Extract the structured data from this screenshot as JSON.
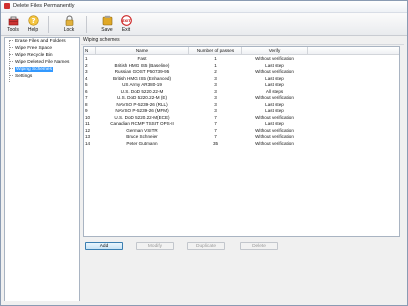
{
  "window": {
    "title": "Delete Files Permanently"
  },
  "toolbar": {
    "buttons": [
      {
        "label": "Tools",
        "icon": "tools-icon"
      },
      {
        "label": "Help",
        "icon": "help-icon"
      },
      {
        "label": "Lock",
        "icon": "lock-icon"
      },
      {
        "label": "Save",
        "icon": "save-icon"
      },
      {
        "label": "Exit",
        "icon": "exit-icon"
      }
    ]
  },
  "tree": {
    "items": [
      {
        "label": "Erase Files and Folders"
      },
      {
        "label": "Wipe Free Space"
      },
      {
        "label": "Wipe Recycle Bin"
      },
      {
        "label": "Wipe Deleted File Names"
      },
      {
        "label": "Wiping Schemes",
        "selected": true
      },
      {
        "label": "Settings"
      }
    ]
  },
  "panel": {
    "title": "Wiping schemes"
  },
  "table": {
    "headers": {
      "n": "N",
      "name": "Name",
      "passes": "Number of passes",
      "verify": "Verify"
    },
    "rows": [
      {
        "n": "1",
        "name": "Fast",
        "passes": "1",
        "verify": "Without verification"
      },
      {
        "n": "2",
        "name": "British HMG IS5 (Baseline)",
        "passes": "1",
        "verify": "Last step"
      },
      {
        "n": "3",
        "name": "Russian GOST P50739-95",
        "passes": "2",
        "verify": "Without verification"
      },
      {
        "n": "4",
        "name": "British HMG IS5 (Enhanced)",
        "passes": "3",
        "verify": "Last step"
      },
      {
        "n": "5",
        "name": "US Army AR380-19",
        "passes": "3",
        "verify": "Last step"
      },
      {
        "n": "6",
        "name": "U.S. DoD 5220.22-M",
        "passes": "3",
        "verify": "All steps"
      },
      {
        "n": "7",
        "name": "U.S. DoD 5220.22-M (E)",
        "passes": "3",
        "verify": "Without verification"
      },
      {
        "n": "8",
        "name": "NAVSO P-5239-26 (RLL)",
        "passes": "3",
        "verify": "Last step"
      },
      {
        "n": "9",
        "name": "NAVSO P-5239-26 (MFM)",
        "passes": "3",
        "verify": "Last step"
      },
      {
        "n": "10",
        "name": "U.S. DoD 5220.22-M(ECE)",
        "passes": "7",
        "verify": "Without verification"
      },
      {
        "n": "11",
        "name": "Canadian RCMP TSSIT OPS-II",
        "passes": "7",
        "verify": "Last step"
      },
      {
        "n": "12",
        "name": "German VSITR",
        "passes": "7",
        "verify": "Without verification"
      },
      {
        "n": "13",
        "name": "Bruce Schneier",
        "passes": "7",
        "verify": "Without verification"
      },
      {
        "n": "14",
        "name": "Peter Gutmann",
        "passes": "35",
        "verify": "Without verification"
      }
    ]
  },
  "actions": {
    "add": "Add",
    "modify": "Modify",
    "duplicate": "Duplicate",
    "delete": "Delete"
  },
  "colors": {
    "selection": "#3399ff",
    "exit_red": "#cc2222",
    "save_gold": "#e0a826"
  }
}
